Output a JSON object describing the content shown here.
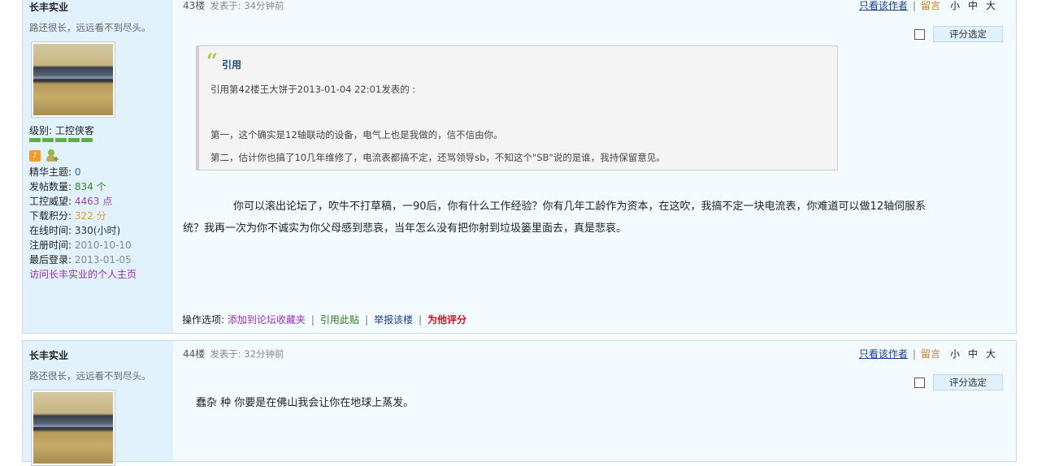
{
  "post1": {
    "user": {
      "name": "长丰实业",
      "signature": "路还很长，远远看不到尽头。",
      "level_label": "级别: ",
      "level": "工控侠客",
      "stats": [
        {
          "key": "精华主题: ",
          "value": "0"
        },
        {
          "key": "发帖数量: ",
          "value": "834 个"
        },
        {
          "key": "工控威望: ",
          "value": "4463 点"
        },
        {
          "key": "下载积分: ",
          "value": "322 分"
        },
        {
          "key": "在线时间: ",
          "value": "330(小时)"
        },
        {
          "key": "注册时间: ",
          "value": "2010-10-10"
        },
        {
          "key": "最后登录: ",
          "value": "2013-01-05"
        }
      ],
      "visit_link": "访问长丰实业的个人主页"
    },
    "floor": "43楼",
    "posted": "发表于: 34分钟前",
    "tools": {
      "author_only": "只看该作者",
      "message": "留言",
      "sep": "|",
      "small": "小",
      "medium": "中",
      "large": "大"
    },
    "rate_button": "评分选定",
    "quote": {
      "title": "引用",
      "lines": [
        "引用第42楼王大饼于2013-01-04 22:01发表的 :",
        "第一，这个确实是12轴联动的设备，电气上也是我做的，信不信由你。",
        "第二，估计你也搞了10几年维修了，电流表都搞不定，还骂领导sb，不知这个\"SB\"说的是谁，我持保留意见。"
      ]
    },
    "content_line1": "你可以滚出论坛了，吹牛不打草稿，一90后，你有什么工作经验？你有几年工龄作为资本，在这吹，我搞不定一块电流表，你难道可以做12轴伺服系",
    "content_line2": "统？我再一次为你不诚实为你父母感到悲哀，当年怎么没有把你射到垃圾篓里面去，真是悲哀。",
    "ops": {
      "label": "操作选项: ",
      "fav": "添加到论坛收藏夹",
      "quote": "引用此贴",
      "report": "举报该楼",
      "rate": "为他评分",
      "sep": "|"
    }
  },
  "post2": {
    "user": {
      "name": "长丰实业",
      "signature": "路还很长，远远看不到尽头。"
    },
    "floor": "44楼",
    "posted": "发表于: 32分钟前",
    "tools": {
      "author_only": "只看该作者",
      "message": "留言",
      "sep": "|",
      "small": "小",
      "medium": "中",
      "large": "大"
    },
    "rate_button": "评分选定",
    "content": "蠢杂  种  你要是在佛山我会让你在地球上蒸发。"
  }
}
